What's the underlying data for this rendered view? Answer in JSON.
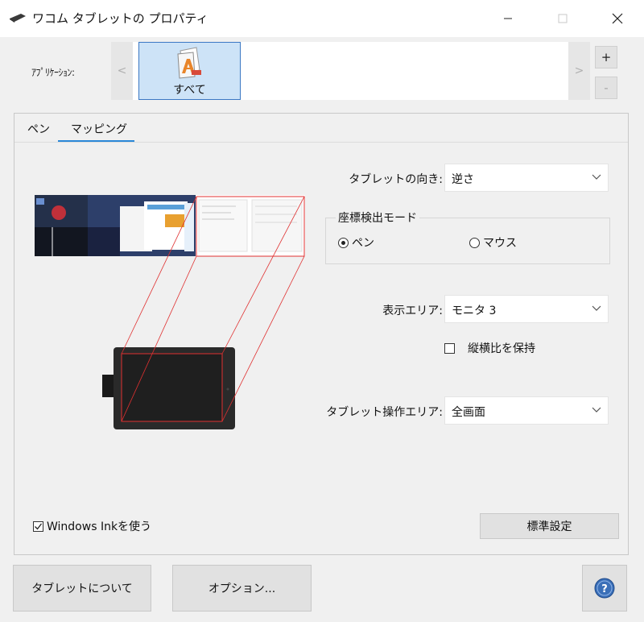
{
  "window": {
    "title": "ワコム タブレットの プロパティ",
    "icons": {
      "app": "tablet-pen-icon",
      "minimize": "minimize-icon",
      "maximize": "maximize-icon",
      "close": "close-icon"
    }
  },
  "applications": {
    "label": "ｱﾌﾟﾘｹｰｼｮﾝ:",
    "scroll_left": "<",
    "scroll_right": ">",
    "selected": {
      "label": "すべて",
      "icon": "all-applications-icon"
    },
    "add_label": "+",
    "remove_label": "-"
  },
  "tabs": [
    {
      "label": "ペン",
      "active": false
    },
    {
      "label": "マッピング",
      "active": true
    }
  ],
  "mapping": {
    "orientation": {
      "label": "タブレットの向き:",
      "value": "逆さ"
    },
    "mode_group": {
      "title": "座標検出モード",
      "options": [
        {
          "label": "ペン",
          "checked": true
        },
        {
          "label": "マウス",
          "checked": false
        }
      ]
    },
    "display_area": {
      "label": "表示エリア:",
      "value": "モニタ 3"
    },
    "keep_aspect": {
      "label": "縦横比を保持",
      "checked": false
    },
    "tablet_area": {
      "label": "タブレット操作エリア:",
      "value": "全画面"
    },
    "windows_ink": {
      "label": "Windows Inkを使う",
      "checked": true
    },
    "default_button": "標準設定"
  },
  "footer": {
    "about_button": "タブレットについて",
    "options_button": "オプション...",
    "help_icon": "help-icon"
  },
  "colors": {
    "accent": "#2b88d8",
    "mapping_line": "#e03030",
    "selected_tile": "#cde3f7",
    "help_blue": "#3a6fb8"
  }
}
